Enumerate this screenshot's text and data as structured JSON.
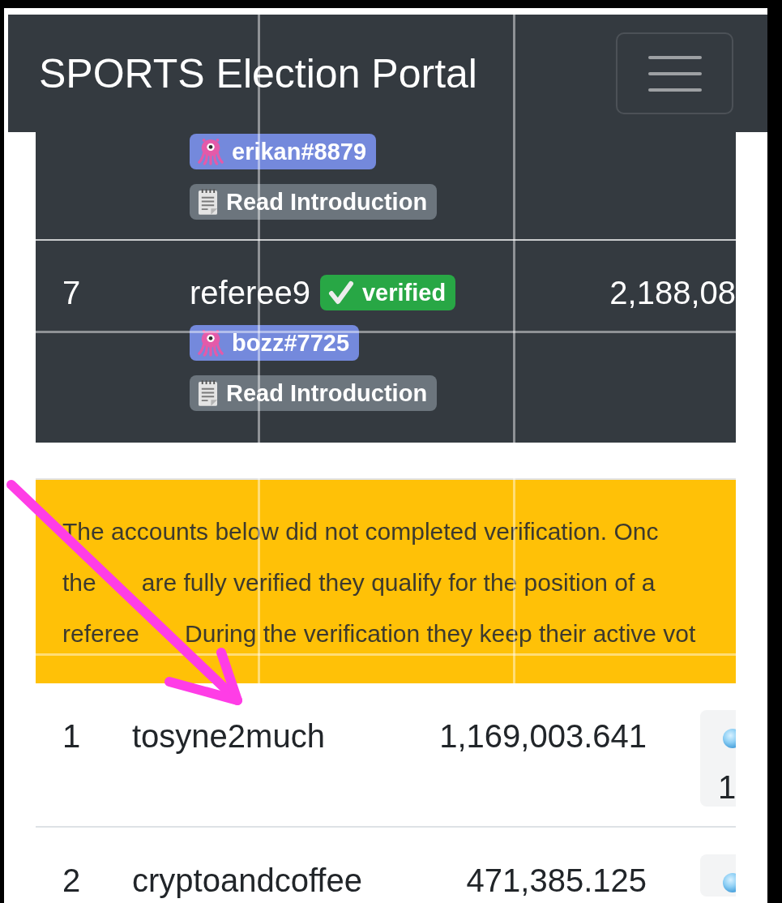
{
  "navbar": {
    "title": "SPORTS Election Portal"
  },
  "referee_table": {
    "rows": [
      {
        "discord_tag": "erikan#8879",
        "intro_link": "Read Introduction"
      },
      {
        "rank": "7",
        "name": "referee9",
        "verified": true,
        "verified_label": "verified",
        "votes": "2,188,08",
        "discord_tag": "bozz#7725",
        "intro_link": "Read Introduction"
      }
    ]
  },
  "notice": {
    "lines": [
      [
        "The accounts below did not completed verification. Onc"
      ],
      [
        "the",
        "are fully verified they qualify for the position of a"
      ],
      [
        "referee",
        "During the verification they keep their active vot"
      ]
    ]
  },
  "candidate_table": {
    "rows": [
      {
        "rank": "1",
        "name": "tosyne2much",
        "votes": "1,169,003.641",
        "column_4": "1"
      },
      {
        "rank": "2",
        "name": "cryptoandcoffee",
        "votes": "471,385.125"
      }
    ]
  },
  "annotation": {
    "kind": "arrow"
  }
}
